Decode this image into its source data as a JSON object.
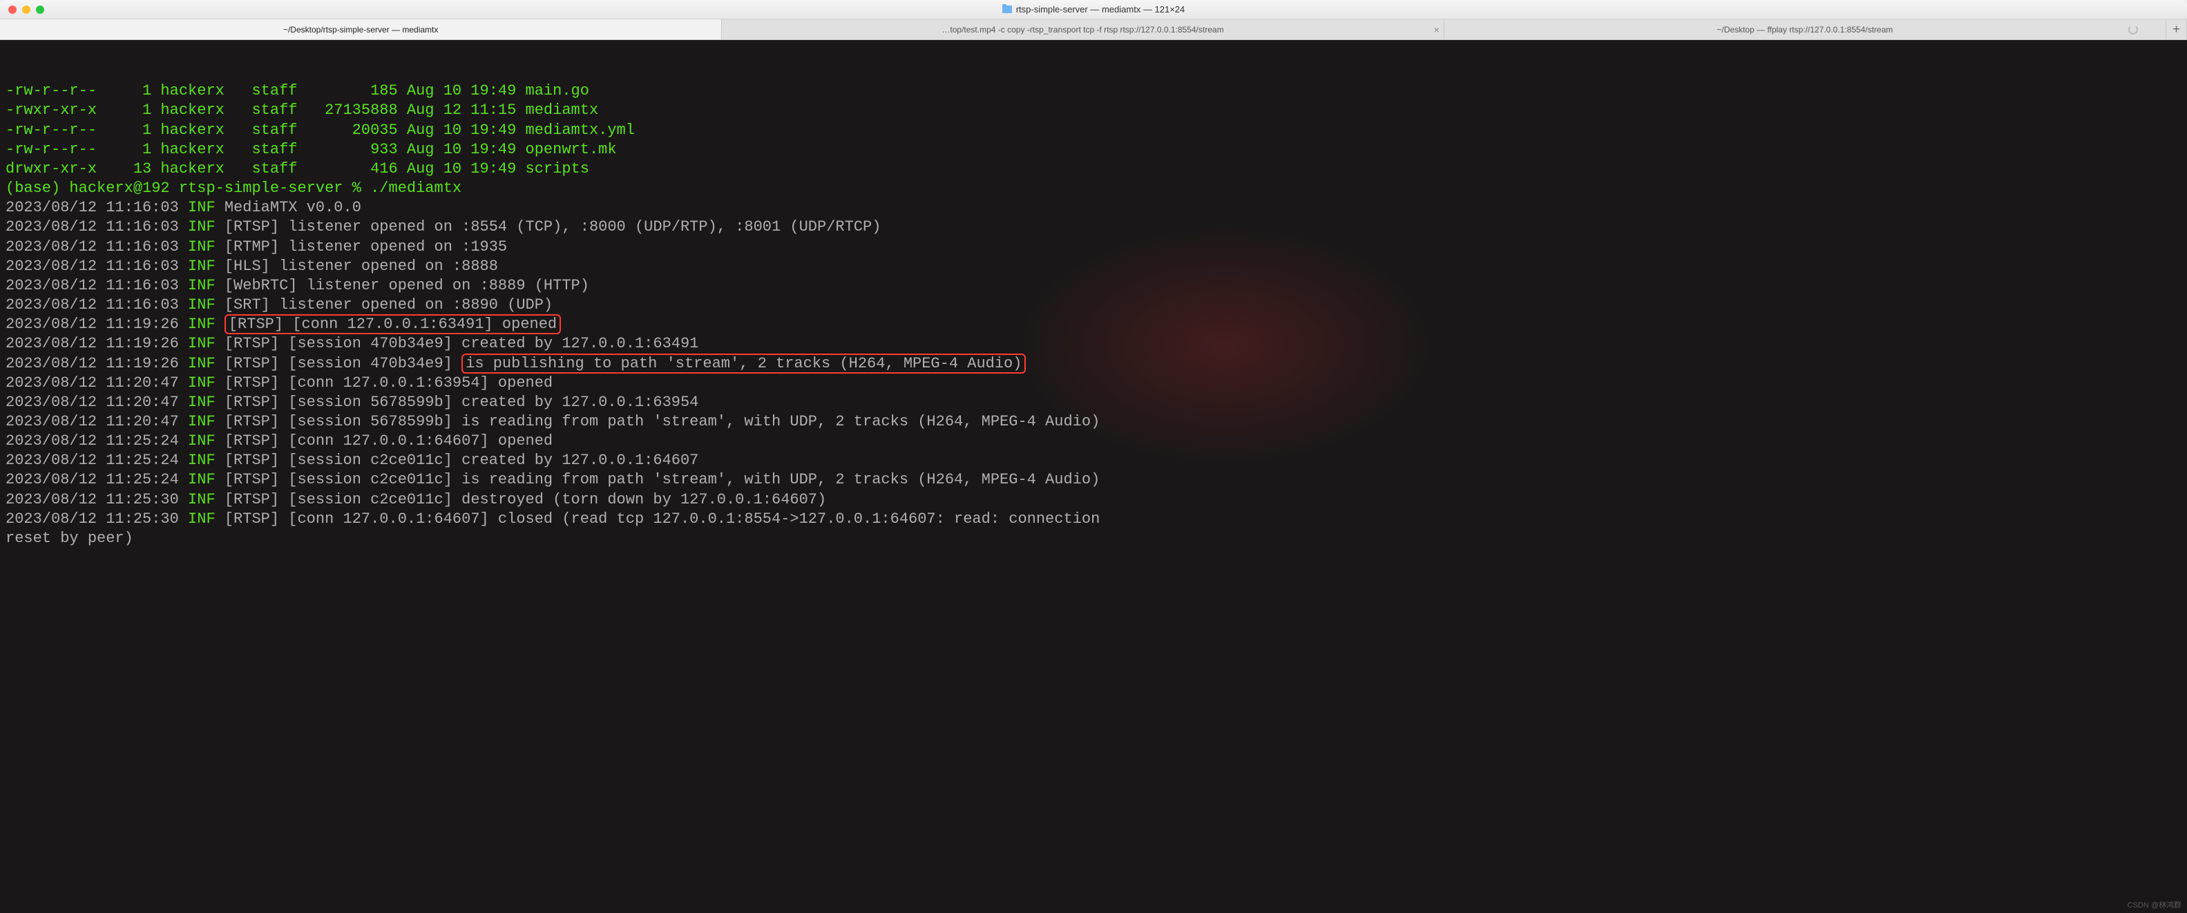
{
  "window": {
    "title": "rtsp-simple-server — mediamtx — 121×24"
  },
  "tabs": [
    {
      "label": "~/Desktop/rtsp-simple-server — mediamtx",
      "active": true
    },
    {
      "label": "…top/test.mp4 -c copy -rtsp_transport tcp -f rtsp rtsp://127.0.0.1:8554/stream",
      "active": false,
      "hasClose": true
    },
    {
      "label": "~/Desktop — ffplay rtsp://127.0.0.1:8554/stream",
      "active": false,
      "hasSpinner": true
    }
  ],
  "ls": [
    {
      "perm": "-rw-r--r--",
      "links": "1",
      "owner": "hackerx",
      "group": "staff",
      "size": "185",
      "date": "Aug 10 19:49",
      "name": "main.go"
    },
    {
      "perm": "-rwxr-xr-x",
      "links": "1",
      "owner": "hackerx",
      "group": "staff",
      "size": "27135888",
      "date": "Aug 12 11:15",
      "name": "mediamtx"
    },
    {
      "perm": "-rw-r--r--",
      "links": "1",
      "owner": "hackerx",
      "group": "staff",
      "size": "20035",
      "date": "Aug 10 19:49",
      "name": "mediamtx.yml"
    },
    {
      "perm": "-rw-r--r--",
      "links": "1",
      "owner": "hackerx",
      "group": "staff",
      "size": "933",
      "date": "Aug 10 19:49",
      "name": "openwrt.mk"
    },
    {
      "perm": "drwxr-xr-x",
      "links": "13",
      "owner": "hackerx",
      "group": "staff",
      "size": "416",
      "date": "Aug 10 19:49",
      "name": "scripts"
    }
  ],
  "prompt": {
    "prefix": "(base) hackerx@192 rtsp-simple-server % ",
    "cmd": "./mediamtx"
  },
  "logs": [
    {
      "ts": "2023/08/12 11:16:03",
      "lvl": "INF",
      "msg": "MediaMTX v0.0.0"
    },
    {
      "ts": "2023/08/12 11:16:03",
      "lvl": "INF",
      "msg": "[RTSP] listener opened on :8554 (TCP), :8000 (UDP/RTP), :8001 (UDP/RTCP)"
    },
    {
      "ts": "2023/08/12 11:16:03",
      "lvl": "INF",
      "msg": "[RTMP] listener opened on :1935"
    },
    {
      "ts": "2023/08/12 11:16:03",
      "lvl": "INF",
      "msg": "[HLS] listener opened on :8888"
    },
    {
      "ts": "2023/08/12 11:16:03",
      "lvl": "INF",
      "msg": "[WebRTC] listener opened on :8889 (HTTP)"
    },
    {
      "ts": "2023/08/12 11:16:03",
      "lvl": "INF",
      "msg": "[SRT] listener opened on :8890 (UDP)"
    },
    {
      "ts": "2023/08/12 11:19:26",
      "lvl": "INF",
      "msg_pre": "",
      "msg_box": "[RTSP] [conn 127.0.0.1:63491] opened",
      "special": "box_full"
    },
    {
      "ts": "2023/08/12 11:19:26",
      "lvl": "INF",
      "msg": "[RTSP] [session 470b34e9] created by 127.0.0.1:63491"
    },
    {
      "ts": "2023/08/12 11:19:26",
      "lvl": "INF",
      "msg_pre": "[RTSP] [session 470b34e9] ",
      "msg_box": "is publishing to path 'stream', 2 tracks (H264, MPEG-4 Audio)",
      "special": "box_partial"
    },
    {
      "ts": "2023/08/12 11:20:47",
      "lvl": "INF",
      "msg": "[RTSP] [conn 127.0.0.1:63954] opened"
    },
    {
      "ts": "2023/08/12 11:20:47",
      "lvl": "INF",
      "msg": "[RTSP] [session 5678599b] created by 127.0.0.1:63954"
    },
    {
      "ts": "2023/08/12 11:20:47",
      "lvl": "INF",
      "msg": "[RTSP] [session 5678599b] is reading from path 'stream', with UDP, 2 tracks (H264, MPEG-4 Audio)"
    },
    {
      "ts": "2023/08/12 11:25:24",
      "lvl": "INF",
      "msg": "[RTSP] [conn 127.0.0.1:64607] opened"
    },
    {
      "ts": "2023/08/12 11:25:24",
      "lvl": "INF",
      "msg": "[RTSP] [session c2ce011c] created by 127.0.0.1:64607"
    },
    {
      "ts": "2023/08/12 11:25:24",
      "lvl": "INF",
      "msg": "[RTSP] [session c2ce011c] is reading from path 'stream', with UDP, 2 tracks (H264, MPEG-4 Audio)"
    },
    {
      "ts": "2023/08/12 11:25:30",
      "lvl": "INF",
      "msg": "[RTSP] [session c2ce011c] destroyed (torn down by 127.0.0.1:64607)"
    },
    {
      "ts": "2023/08/12 11:25:30",
      "lvl": "INF",
      "msg": "[RTSP] [conn 127.0.0.1:64607] closed (read tcp 127.0.0.1:8554->127.0.0.1:64607: read: connection reset by peer)",
      "wrap": true
    }
  ],
  "watermark": "CSDN @林鸿群"
}
